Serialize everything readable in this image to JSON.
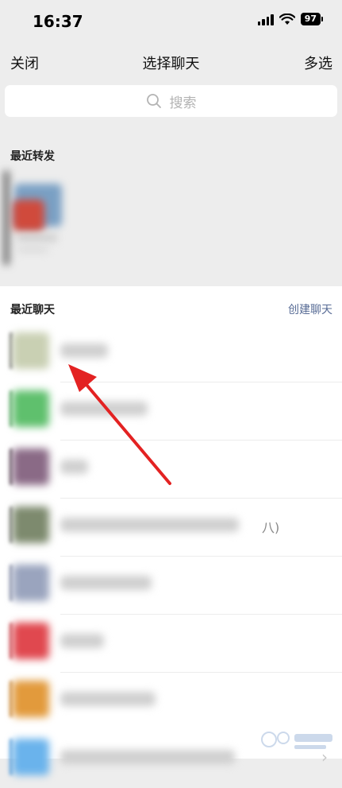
{
  "status": {
    "time": "16:37",
    "battery": "97"
  },
  "nav": {
    "close": "关闭",
    "title": "选择聊天",
    "multi_select": "多选"
  },
  "search": {
    "placeholder": "搜索"
  },
  "sections": {
    "recent_forward": "最近转发",
    "recent_chat": "最近聊天",
    "create_chat": "创建聊天"
  },
  "chats": [
    {
      "avatar_color": "#c9d0b3",
      "edge_color": "#555555",
      "name_width": 60,
      "divider": false
    },
    {
      "avatar_color": "#5fc06d",
      "edge_color": "#3e8f4b",
      "name_width": 110,
      "divider": true
    },
    {
      "avatar_color": "#8a6a86",
      "edge_color": "#3b2a37",
      "name_width": 35,
      "divider": true
    },
    {
      "avatar_color": "#7d8a6e",
      "edge_color": "#5e5e5e",
      "name_width": 225,
      "divider": true,
      "trailing": "八)"
    },
    {
      "avatar_color": "#9aa4be",
      "edge_color": "#6c7390",
      "name_width": 115,
      "divider": true
    },
    {
      "avatar_color": "#e0484f",
      "edge_color": "#b8313a",
      "name_width": 55,
      "divider": true
    },
    {
      "avatar_color": "#e29a3c",
      "edge_color": "#b97424",
      "name_width": 120,
      "divider": true
    },
    {
      "avatar_color": "#6ab3ec",
      "edge_color": "#3b8cd0",
      "name_width": 220,
      "divider": false,
      "arrow": true
    }
  ],
  "colors": {
    "accent_link": "#576b95",
    "annotation_arrow": "#e32222"
  }
}
